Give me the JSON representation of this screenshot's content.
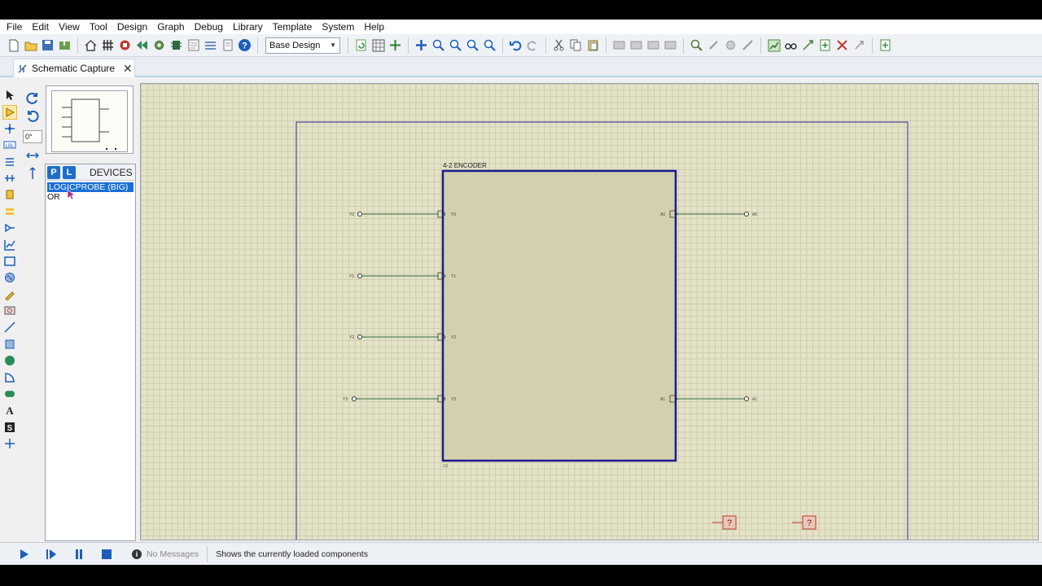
{
  "menu": [
    "File",
    "Edit",
    "View",
    "Tool",
    "Design",
    "Graph",
    "Debug",
    "Library",
    "Template",
    "System",
    "Help"
  ],
  "toolbar": {
    "design_select": "Base Design"
  },
  "tab": {
    "label": "Schematic Capture",
    "close": "✕"
  },
  "orientation": {
    "angle": "0°"
  },
  "devices": {
    "p_label": "P",
    "l_label": "L",
    "title": "DEVICES",
    "items": [
      {
        "name": "LOGICPROBE (BIG)",
        "selected": true
      },
      {
        "name": "OR",
        "selected": false
      }
    ]
  },
  "schematic": {
    "component_title": "4-2 ENCODER",
    "component_ref": "U1",
    "inputs": [
      "Y0",
      "Y1",
      "Y2",
      "Y3"
    ],
    "outputs": [
      "A0",
      "A1"
    ],
    "probe_symbol": "?"
  },
  "status": {
    "messages": "No Messages",
    "hint": "Shows the currently loaded components"
  },
  "colors": {
    "component_border": "#1a1a8c",
    "component_fill": "#d4d0ae",
    "wire": "#2f6b4a",
    "probe": "#c0392b",
    "selection": "#1a6fd6"
  }
}
